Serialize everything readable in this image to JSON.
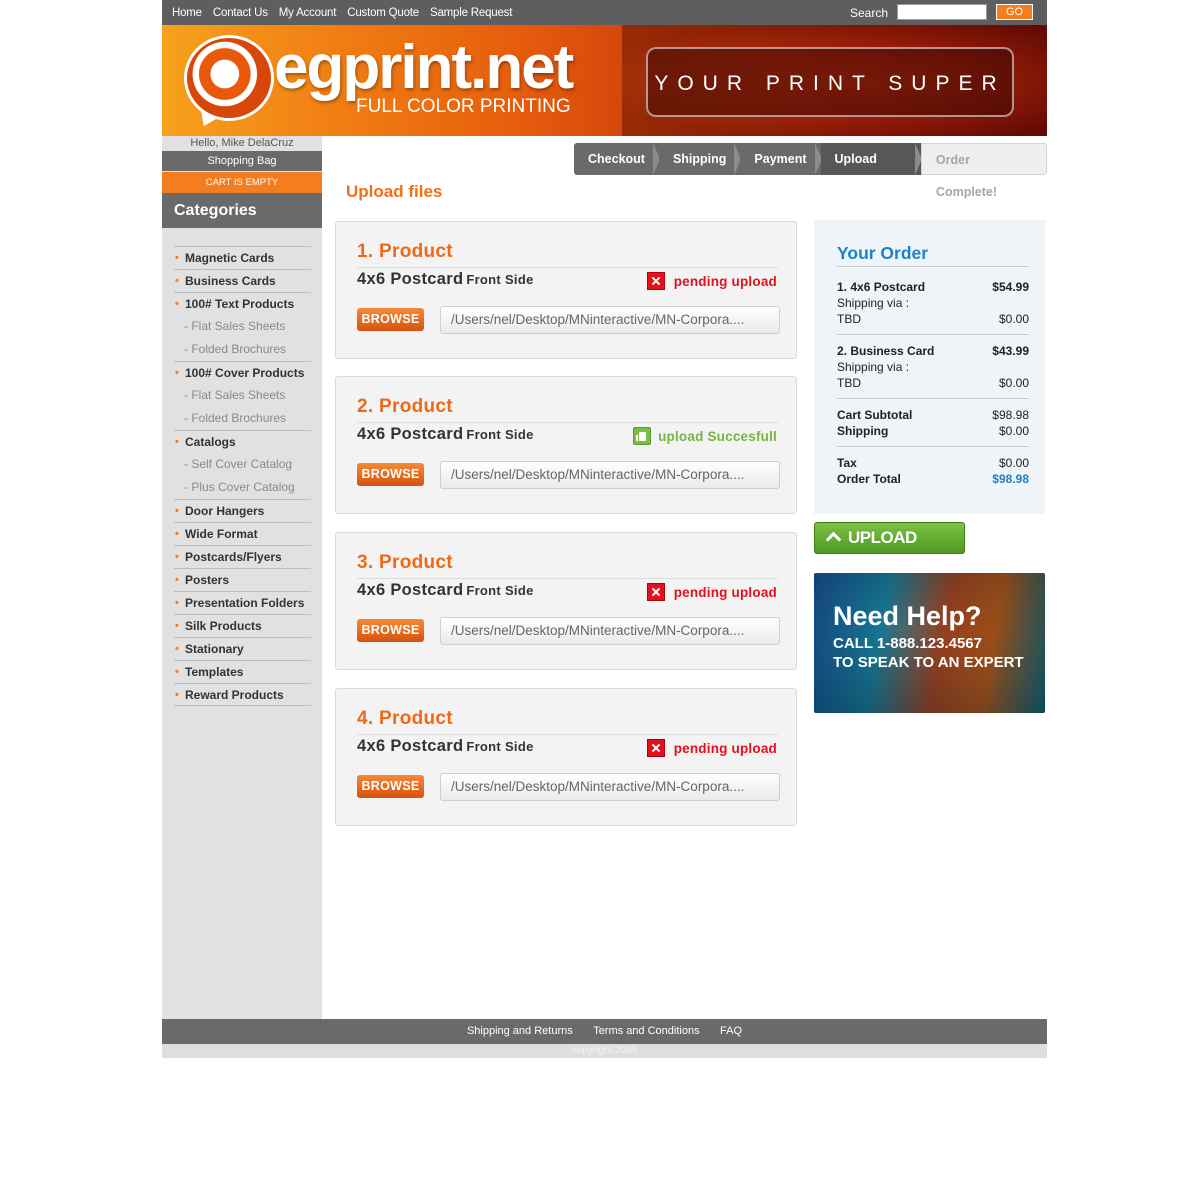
{
  "topnav": {
    "links": [
      "Home",
      "Contact Us",
      "My Account",
      "Custom Quote",
      "Sample Request"
    ],
    "search_label": "Search",
    "search_value": "",
    "go_label": "GO"
  },
  "banner": {
    "brand": "egprint.net",
    "tagline": "FULL COLOR PRINTING",
    "slogan": "YOUR PRINT SUPER STORE"
  },
  "sidebar": {
    "hello": "Hello, Mike DelaCruz",
    "bag": "Shopping Bag",
    "cart_status": "CART IS EMPTY",
    "categories_title": "Categories",
    "items": [
      {
        "label": "Magnetic Cards",
        "type": "main"
      },
      {
        "label": "Business Cards",
        "type": "main"
      },
      {
        "label": "100# Text Products",
        "type": "main"
      },
      {
        "label": "- Flat Sales Sheets",
        "type": "sub"
      },
      {
        "label": "- Folded Brochures",
        "type": "sub"
      },
      {
        "label": "100# Cover Products",
        "type": "main"
      },
      {
        "label": "- Flat Sales Sheets",
        "type": "sub"
      },
      {
        "label": "- Folded Brochures",
        "type": "sub"
      },
      {
        "label": "Catalogs",
        "type": "main"
      },
      {
        "label": "- Self Cover Catalog",
        "type": "sub"
      },
      {
        "label": "- Plus Cover Catalog",
        "type": "sub"
      },
      {
        "label": "Door Hangers",
        "type": "main"
      },
      {
        "label": "Wide Format",
        "type": "main"
      },
      {
        "label": "Postcards/Flyers",
        "type": "main"
      },
      {
        "label": "Posters",
        "type": "main"
      },
      {
        "label": "Presentation Folders",
        "type": "main"
      },
      {
        "label": "Silk Products",
        "type": "main"
      },
      {
        "label": "Stationary",
        "type": "main"
      },
      {
        "label": "Templates",
        "type": "main"
      },
      {
        "label": "Reward Products",
        "type": "main"
      }
    ]
  },
  "steps": [
    {
      "label": "Checkout",
      "state": "normal"
    },
    {
      "label": "Shipping",
      "state": "normal"
    },
    {
      "label": "Payment",
      "state": "normal"
    },
    {
      "label": "Upload Files",
      "state": "active"
    },
    {
      "label": "Order Complete!",
      "state": "done"
    }
  ],
  "page_title": "Upload files",
  "products": [
    {
      "number": "1. Product",
      "name": "4x6 Postcard",
      "side": "Front Side",
      "status": "pending upload",
      "status_type": "pending",
      "browse": "BROWSE",
      "path": "/Users/nel/Desktop/MNinteractive/MN-Corpora...."
    },
    {
      "number": "2. Product",
      "name": "4x6 Postcard",
      "side": "Front Side",
      "status": "upload Succesfull",
      "status_type": "ok",
      "browse": "BROWSE",
      "path": "/Users/nel/Desktop/MNinteractive/MN-Corpora...."
    },
    {
      "number": "3. Product",
      "name": "4x6 Postcard",
      "side": "Front Side",
      "status": "pending upload",
      "status_type": "pending",
      "browse": "BROWSE",
      "path": "/Users/nel/Desktop/MNinteractive/MN-Corpora...."
    },
    {
      "number": "4. Product",
      "name": "4x6 Postcard",
      "side": "Front Side",
      "status": "pending upload",
      "status_type": "pending",
      "browse": "BROWSE",
      "path": "/Users/nel/Desktop/MNinteractive/MN-Corpora...."
    }
  ],
  "order": {
    "title": "Your Order",
    "item1": {
      "name": "1. 4x6 Postcard",
      "price": "$54.99",
      "ship_label": "Shipping via :",
      "ship_method": "TBD",
      "ship_price": "$0.00"
    },
    "item2": {
      "name": "2.  Business Card",
      "price": "$43.99",
      "ship_label": "Shipping via :",
      "ship_method": "TBD",
      "ship_price": "$0.00"
    },
    "subtotal_label": "Cart Subtotal",
    "subtotal": "$98.98",
    "shipping_label": "Shipping",
    "shipping": "$0.00",
    "tax_label": "Tax",
    "tax": "$0.00",
    "total_label": "Order Total",
    "total": "$98.98"
  },
  "upload_button": "UPLOAD FILES",
  "help": {
    "title": "Need Help?",
    "line1": "CALL 1-888.123.4567",
    "line2": "TO SPEAK TO AN EXPERT"
  },
  "footer": {
    "links": [
      "Shipping and Returns",
      "Terms and Conditions",
      "FAQ"
    ],
    "copyright": "copyright 2005"
  },
  "colors": {
    "accent": "#f47d20",
    "blue": "#1e82c6",
    "green": "#78b347",
    "red": "#e2111e",
    "gray": "#6a6a6a"
  }
}
